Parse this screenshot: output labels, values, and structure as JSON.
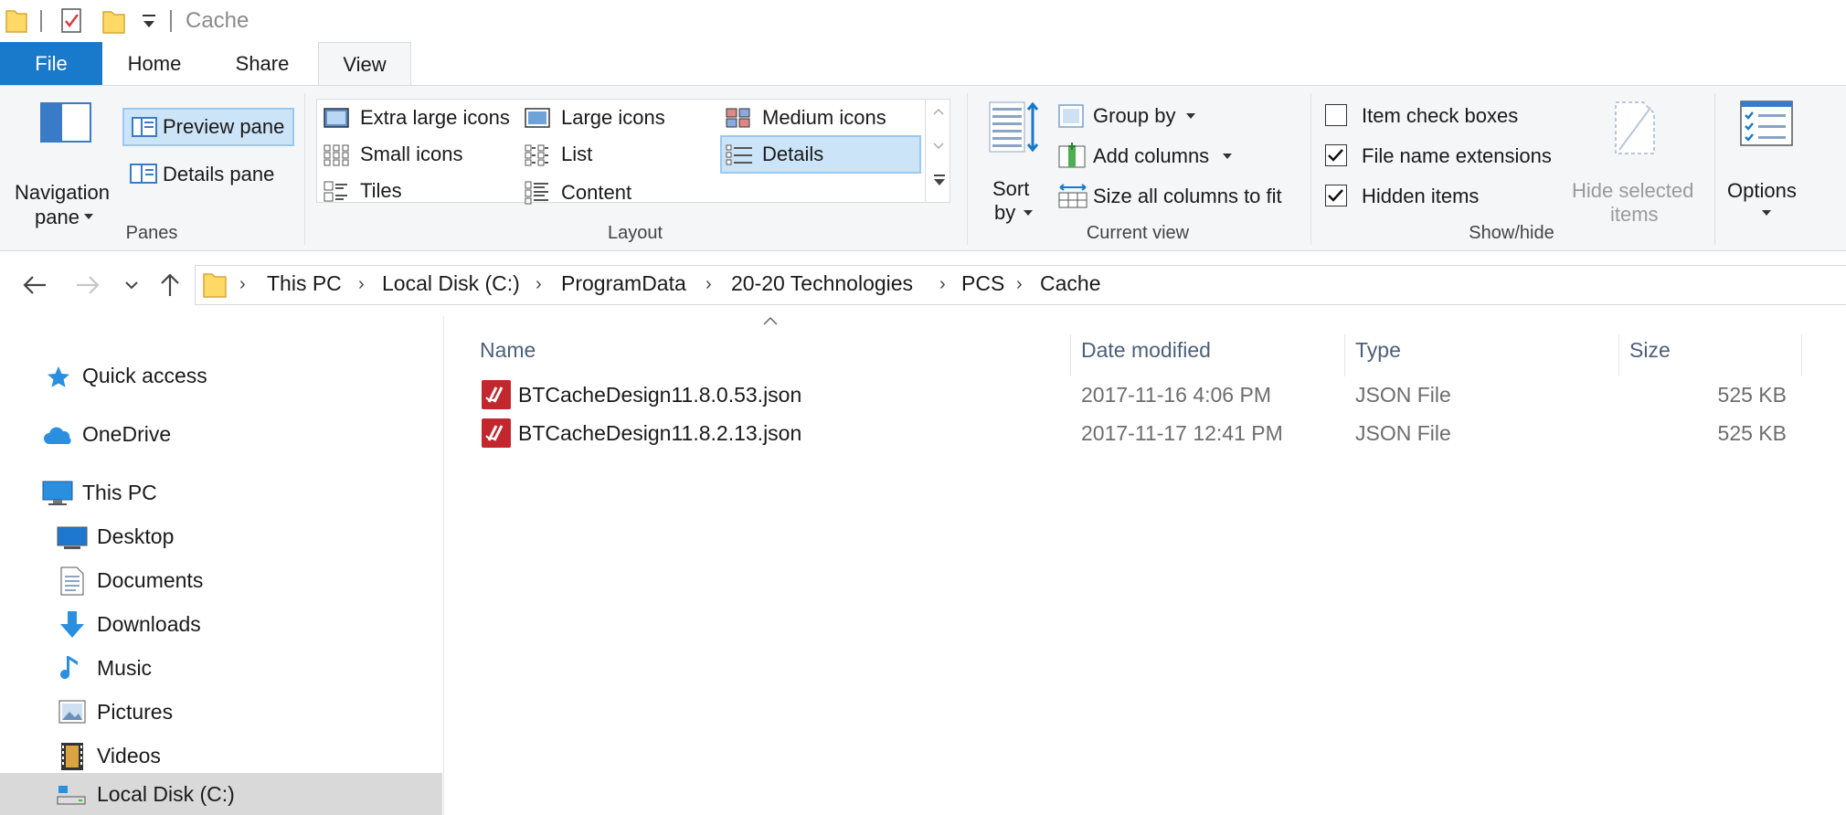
{
  "window": {
    "title": "Cache"
  },
  "tabs": [
    {
      "label": "File"
    },
    {
      "label": "Home"
    },
    {
      "label": "Share"
    },
    {
      "label": "View"
    }
  ],
  "ribbon": {
    "panes": {
      "label": "Panes",
      "navigation_pane": "Navigation",
      "navigation_pane_sub": "pane",
      "preview_pane": "Preview pane",
      "details_pane": "Details pane"
    },
    "layout": {
      "label": "Layout",
      "items": [
        {
          "label": "Extra large icons"
        },
        {
          "label": "Large icons"
        },
        {
          "label": "Medium icons"
        },
        {
          "label": "Small icons"
        },
        {
          "label": "List"
        },
        {
          "label": "Details"
        },
        {
          "label": "Tiles"
        },
        {
          "label": "Content"
        }
      ],
      "selected": "Details"
    },
    "current_view": {
      "label": "Current view",
      "sort_by": "Sort",
      "sort_by_sub": "by",
      "group_by": "Group by",
      "add_columns": "Add columns",
      "size_all_columns": "Size all columns to fit"
    },
    "show_hide": {
      "label": "Show/hide",
      "item_check_boxes": {
        "label": "Item check boxes",
        "checked": false
      },
      "file_name_extensions": {
        "label": "File name extensions",
        "checked": true
      },
      "hidden_items": {
        "label": "Hidden items",
        "checked": true
      },
      "hide_selected": "Hide selected",
      "hide_selected_sub": "items"
    },
    "options": {
      "label": "Options"
    }
  },
  "address": {
    "crumbs": [
      "This PC",
      "Local Disk (C:)",
      "ProgramData",
      "20-20 Technologies",
      "PCS",
      "Cache"
    ]
  },
  "nav": {
    "items": [
      {
        "label": "Quick access",
        "icon": "star-icon"
      },
      {
        "label": "OneDrive",
        "icon": "cloud-icon"
      },
      {
        "label": "This PC",
        "icon": "computer-icon"
      },
      {
        "label": "Desktop",
        "icon": "desktop-icon"
      },
      {
        "label": "Documents",
        "icon": "documents-icon"
      },
      {
        "label": "Downloads",
        "icon": "downloads-icon"
      },
      {
        "label": "Music",
        "icon": "music-icon"
      },
      {
        "label": "Pictures",
        "icon": "pictures-icon"
      },
      {
        "label": "Videos",
        "icon": "videos-icon"
      },
      {
        "label": "Local Disk (C:)",
        "icon": "drive-icon"
      }
    ],
    "selected": "Local Disk (C:)"
  },
  "files": {
    "columns": {
      "name": "Name",
      "date": "Date modified",
      "type": "Type",
      "size": "Size"
    },
    "rows": [
      {
        "name": "BTCacheDesign11.8.0.53.json",
        "date": "2017-11-16 4:06 PM",
        "type": "JSON File",
        "size": "525 KB"
      },
      {
        "name": "BTCacheDesign11.8.2.13.json",
        "date": "2017-11-17 12:41 PM",
        "type": "JSON File",
        "size": "525 KB"
      }
    ]
  },
  "colors": {
    "accent": "#1979ca",
    "selection": "#cce4f7",
    "selection_border": "#99c9ef",
    "json_icon": "#c1272d",
    "folder": "#ffd966"
  }
}
